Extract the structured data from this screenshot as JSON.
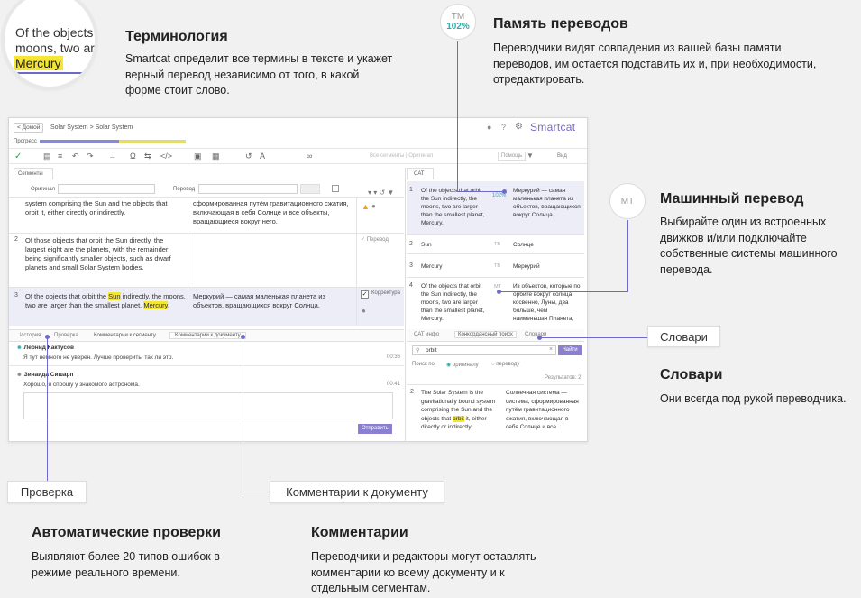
{
  "terminology": {
    "title": "Терминология",
    "desc": "Smartcat определит все термины в тексте и укажет верный перевод независимо от того, в какой форме стоит слово.",
    "zoom_line1": "Of the objects",
    "zoom_line2": "moons, two ar",
    "zoom_term": "Mercury"
  },
  "tm": {
    "title": "Память переводов",
    "desc": "Переводчики видят совпадения из вашей базы памяти переводов, им остается подставить их и, при необходимости, отредактировать.",
    "badge_label": "TM",
    "badge_value": "102%"
  },
  "mt": {
    "title": "Машинный перевод",
    "desc": "Выбирайте один из встроенных движков и/или подключайте собственные системы машинного перевода.",
    "badge_label": "MT"
  },
  "dictionaries": {
    "callout": "Словари",
    "title": "Словари",
    "desc": "Они всегда под рукой переводчика."
  },
  "checks": {
    "callout": "Проверка",
    "title": "Автоматические проверки",
    "desc": "Выявляют более 20 типов ошибок в режиме реального времени."
  },
  "comments": {
    "callout": "Комментарии к документу",
    "title": "Комментарии",
    "desc": "Переводчики и редакторы могут оставлять комментарии ко всему документу и к отдельным сегментам."
  },
  "app": {
    "home": "< Домой",
    "breadcrumb": "Solar System > Solar System",
    "logo": "Smartcat",
    "progress_label": "Прогресс",
    "segments_tab": "Сегменты",
    "source_label": "Оригинал",
    "target_label": "Перевод",
    "all_segments": "Все сегменты | Оригинал",
    "view_label": "Вид",
    "help_label": "Помощь",
    "cat_tab": "CAT",
    "segments": [
      {
        "num": "",
        "src": "system comprising the Sun and the objects that orbit it, either directly or indirectly.",
        "tgt": "сформированная путём гравитационного сжатия, включающая в себя Солнце и все объекты, вращающиеся вокруг него.",
        "status": ""
      },
      {
        "num": "2",
        "src": "Of those objects that orbit the Sun directly, the largest eight are the planets, with the remainder being significantly smaller objects, such as dwarf planets and small Solar System bodies.",
        "tgt": "",
        "status": "Перевод"
      },
      {
        "num": "3",
        "src_a": "Of the objects that orbit the ",
        "src_hl": "Sun",
        "src_b": " indirectly, the moons, two are larger than the smallest planet, ",
        "src_hl2": "Mercury",
        "src_c": ".",
        "tgt": "Меркурий — самая маленькая планета из объектов, вращающихся вокруг Солнца.",
        "status": "Корректура"
      }
    ],
    "cat_rows": [
      {
        "num": "1",
        "src": "Of the objects that orbit the Sun indirectly, the moons, two are larger than the smallest planet, Mercury.",
        "score": "102%",
        "tgt": "Меркурий — самая маленькая планета из объектов, вращающихся вокруг Солнца."
      },
      {
        "num": "2",
        "src": "Sun",
        "score": "TB",
        "tgt": "Солнце"
      },
      {
        "num": "3",
        "src": "Mercury",
        "score": "TB",
        "tgt": "Меркурий"
      },
      {
        "num": "4",
        "src": "Of the objects that orbit the Sun indirectly, the moons, two are larger than the smallest planet, Mercury.",
        "score": "MT",
        "tgt": "Из объектов, которые по орбите вокруг солнца косвенно, Луны, два больше, чем наименьшая Планета,"
      }
    ],
    "bottom_tabs": [
      "История",
      "Проверка",
      "Комментарии к сегменту",
      "Комментарии к документу"
    ],
    "comments": [
      {
        "author": "Леонид Кактусов",
        "text": "Я тут немного не уверен. Лучше проверить, так ли это.",
        "time": "00:36"
      },
      {
        "author": "Зинаида Сишарп",
        "text": "Хорошо, я спрошу у знакомого астронома.",
        "time": "00:41"
      }
    ],
    "send_button": "Отправить",
    "right_tabs": [
      "CAT инфо",
      "Конкордансный поиск",
      "Словари"
    ],
    "search_value": "orbit",
    "find_button": "Найти",
    "search_in": "Поиск по:",
    "radio_source": "оригиналу",
    "radio_target": "переводу",
    "results": "Результатов: 2",
    "conc_num": "2",
    "conc_src_a": "The Solar System is the gravitationally bound system comprising the Sun and the objects that ",
    "conc_src_hl": "orbit",
    "conc_src_b": " it, either directly or indirectly.",
    "conc_tgt": "Солнечная система — система, сформированная путём гравитационного сжатия, включающая в себя Солнце и все"
  },
  "colors": {
    "accent": "#6c6cc8",
    "highlight": "#f4e632",
    "progress_done": "#8a8ad0",
    "progress_pending": "#e6dc6a"
  }
}
